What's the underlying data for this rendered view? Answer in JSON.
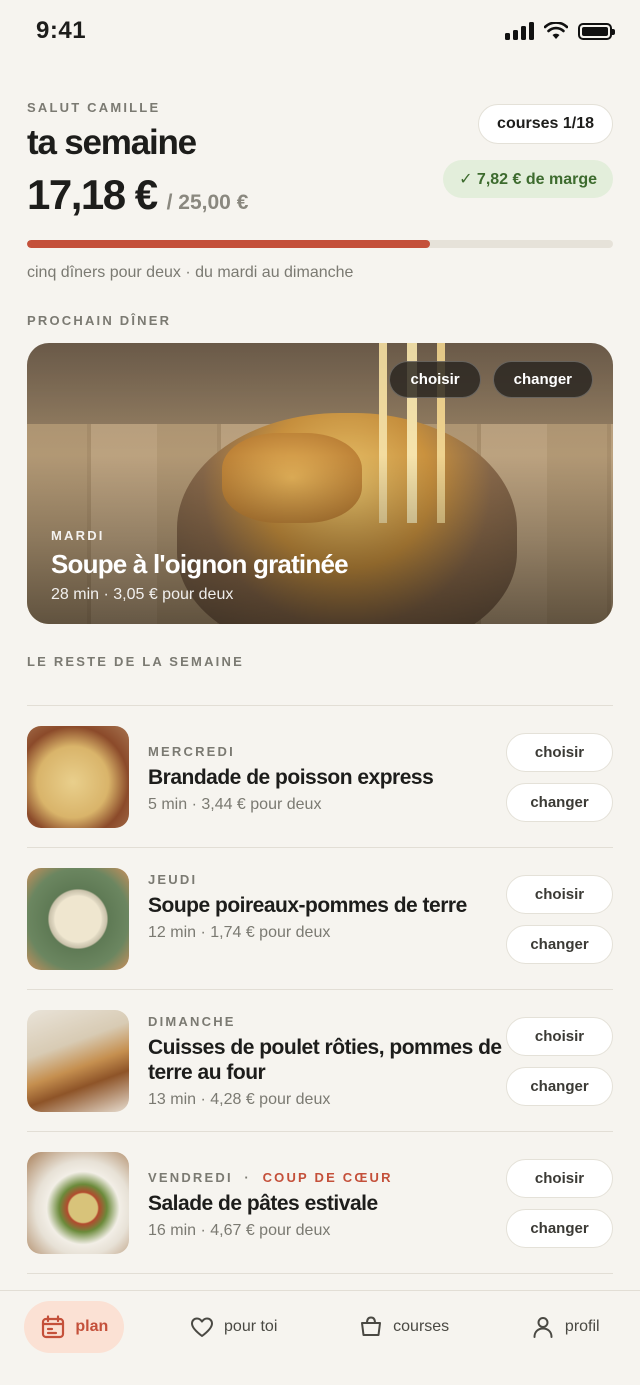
{
  "status_bar": {
    "time": "9:41"
  },
  "header": {
    "greeting": "SALUT CAMILLE",
    "title": "ta semaine",
    "budget_spent": "17,18 €",
    "budget_total": "/ 25,00 €",
    "courses_label": "courses 1/18",
    "margin_label": "✓ 7,82 € de marge",
    "budget_progress": 0.687,
    "subline": "cinq dîners pour deux · du mardi au dimanche"
  },
  "next_dinner": {
    "section_label": "PROCHAIN DÎNER",
    "day": "MARDI",
    "name": "Soupe à l'oignon gratinée",
    "meta": "28 min · 3,05 € pour deux",
    "choose_label": "choisir",
    "change_label": "changer"
  },
  "rest_of_week": {
    "section_label": "LE RESTE DE LA SEMAINE",
    "meals": [
      {
        "day": "MERCREDI",
        "favorite": "",
        "name": "Brandade de poisson express",
        "meta": "5 min · 3,44 € pour deux",
        "choose_label": "choisir",
        "change_label": "changer"
      },
      {
        "day": "JEUDI",
        "favorite": "",
        "name": "Soupe poireaux-pommes de terre",
        "meta": "12 min · 1,74 € pour deux",
        "choose_label": "choisir",
        "change_label": "changer"
      },
      {
        "day": "DIMANCHE",
        "favorite": "",
        "name": "Cuisses de poulet rôties, pommes de terre au four",
        "meta": "13 min · 4,28 € pour deux",
        "choose_label": "choisir",
        "change_label": "changer"
      },
      {
        "day": "VENDREDI",
        "favorite": "COUP DE CŒUR",
        "name": "Salade de pâtes estivale",
        "meta": "16 min · 4,67 € pour deux",
        "choose_label": "choisir",
        "change_label": "changer"
      }
    ]
  },
  "bottom_nav": {
    "items": [
      {
        "label": "plan",
        "icon": "calendar-icon",
        "active": true
      },
      {
        "label": "pour toi",
        "icon": "heart-icon",
        "active": false
      },
      {
        "label": "courses",
        "icon": "basket-icon",
        "active": false
      },
      {
        "label": "profil",
        "icon": "user-icon",
        "active": false
      }
    ]
  },
  "colors": {
    "accent": "#c4503a",
    "background": "#f6f4ef",
    "margin_green": "#3d6b2e"
  }
}
